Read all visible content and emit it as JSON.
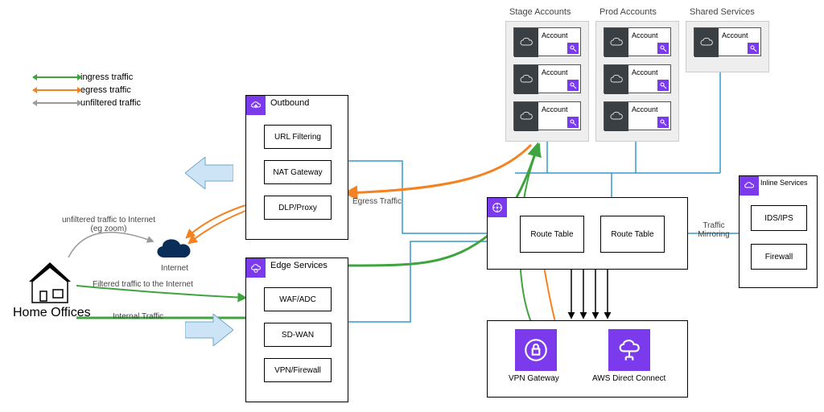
{
  "legend": {
    "ingress": "ingress traffic",
    "egress": "egress traffic",
    "unfiltered": "unfiltered traffic"
  },
  "colors": {
    "ingress": "#3fa33f",
    "egress": "#f58220",
    "unfiltered": "#9a9a9a",
    "link": "#3399cc",
    "purple": "#7c3aed",
    "cloud": "#0b2e59",
    "arrowFill": "#cde4f7"
  },
  "labels": {
    "unfiltered_note": "unfiltered traffic to Internet (eg zoom)",
    "internet": "Internet",
    "filtered": "Filtered traffic to the Internet",
    "internal": "Internal Traffic",
    "home": "Home Offices",
    "egress_path": "Egress Traffic",
    "traffic_mirroring": "Traffic Mirroring"
  },
  "columns": {
    "stage": "Stage Accounts",
    "prod": "Prod Accounts",
    "shared": "Shared Services",
    "account": "Account"
  },
  "outbound": {
    "title": "Outbound",
    "items": [
      "URL Filtering",
      "NAT Gateway",
      "DLP/Proxy"
    ]
  },
  "edge": {
    "title": "Edge Services",
    "items": [
      "WAF/ADC",
      "SD-WAN",
      "VPN/Firewall"
    ]
  },
  "routing": {
    "route_table": "Route Table"
  },
  "connectivity": {
    "vpn": "VPN Gateway",
    "dx": "AWS Direct Connect"
  },
  "inline": {
    "title": "Inline Services",
    "items": [
      "IDS/IPS",
      "Firewall"
    ]
  }
}
